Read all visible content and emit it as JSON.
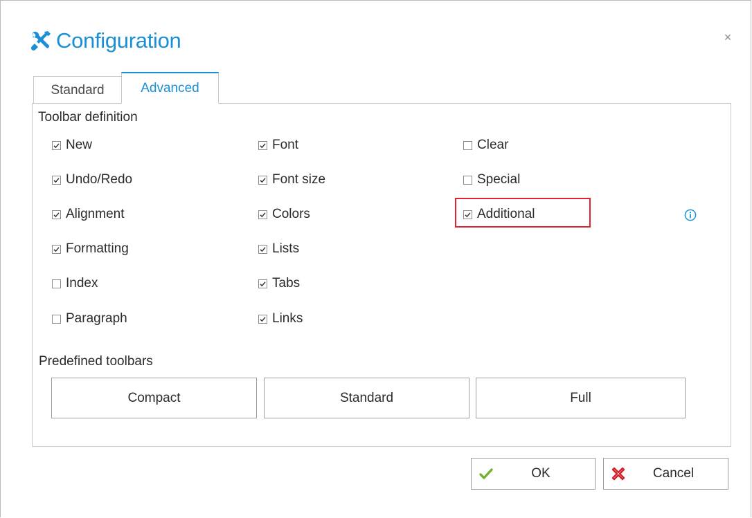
{
  "dialog": {
    "title": "Configuration",
    "close_glyph": "×",
    "title_icon": "tools-icon",
    "accent_color": "#1a8fd8"
  },
  "tabs": [
    {
      "label": "Standard",
      "active": false
    },
    {
      "label": "Advanced",
      "active": true
    }
  ],
  "toolbar_definition": {
    "label": "Toolbar definition",
    "columns": [
      [
        {
          "label": "New",
          "checked": true
        },
        {
          "label": "Undo/Redo",
          "checked": true
        },
        {
          "label": "Alignment",
          "checked": true
        },
        {
          "label": "Formatting",
          "checked": true
        },
        {
          "label": "Index",
          "checked": false
        },
        {
          "label": "Paragraph",
          "checked": false
        }
      ],
      [
        {
          "label": "Font",
          "checked": true
        },
        {
          "label": "Font size",
          "checked": true
        },
        {
          "label": "Colors",
          "checked": true
        },
        {
          "label": "Lists",
          "checked": true
        },
        {
          "label": "Tabs",
          "checked": true
        },
        {
          "label": "Links",
          "checked": true
        }
      ],
      [
        {
          "label": "Clear",
          "checked": false
        },
        {
          "label": "Special",
          "checked": false
        },
        {
          "label": "Additional",
          "checked": true,
          "highlighted": true
        }
      ]
    ],
    "highlight_color": "#e0242e",
    "info_icon": "info-icon"
  },
  "predefined_toolbars": {
    "label": "Predefined toolbars",
    "buttons": [
      {
        "label": "Compact"
      },
      {
        "label": "Standard"
      },
      {
        "label": "Full"
      }
    ]
  },
  "actions": {
    "ok_label": "OK",
    "ok_icon": "checkmark-icon",
    "cancel_label": "Cancel",
    "cancel_icon": "cancel-x-icon"
  }
}
